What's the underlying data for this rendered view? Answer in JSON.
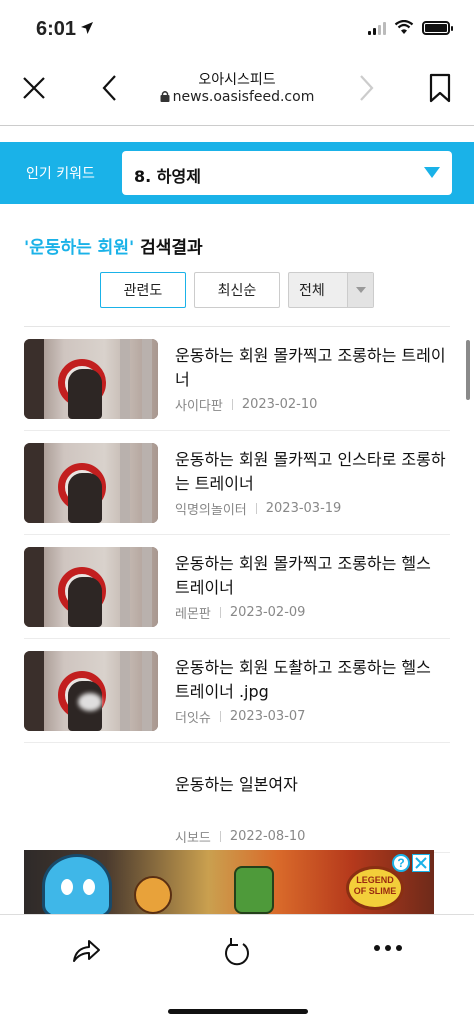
{
  "status_bar": {
    "time": "6:01"
  },
  "browser": {
    "site_title": "오아시스피드",
    "url": "news.oasisfeed.com"
  },
  "keyword_bar": {
    "label": "인기 키워드",
    "selected": "8. 하영제"
  },
  "results": {
    "query": "'운동하는 회원'",
    "suffix": " 검색결과",
    "sort": {
      "relevance": "관련도",
      "latest": "최신순",
      "filter": "전체"
    },
    "items": [
      {
        "title": "운동하는 회원 몰카찍고 조롱하는 트레이너",
        "source": "사이다판",
        "date": "2023-02-10"
      },
      {
        "title": "운동하는 회원 몰카찍고 인스타로 조롱하는 트레이너",
        "source": "익명의놀이터",
        "date": "2023-03-19"
      },
      {
        "title": "운동하는 회원 몰카찍고 조롱하는 헬스 트레이너",
        "source": "레몬판",
        "date": "2023-02-09"
      },
      {
        "title": "운동하는 회원 도촬하고 조롱하는 헬스 트레이너 .jpg",
        "source": "더잇슈",
        "date": "2023-03-07"
      },
      {
        "title": "운동하는 일본여자",
        "source": "시보드",
        "date": "2022-08-10"
      }
    ]
  },
  "ad": {
    "logo_text": "LEGEND OF SLIME",
    "info_label": "?"
  },
  "colors": {
    "accent": "#1ab2e8",
    "meta_text": "#888888"
  },
  "icons": [
    "close-icon",
    "back-icon",
    "forward-icon",
    "bookmark-icon",
    "lock-icon",
    "dropdown-arrow-icon",
    "share-icon",
    "refresh-icon",
    "more-icon"
  ]
}
